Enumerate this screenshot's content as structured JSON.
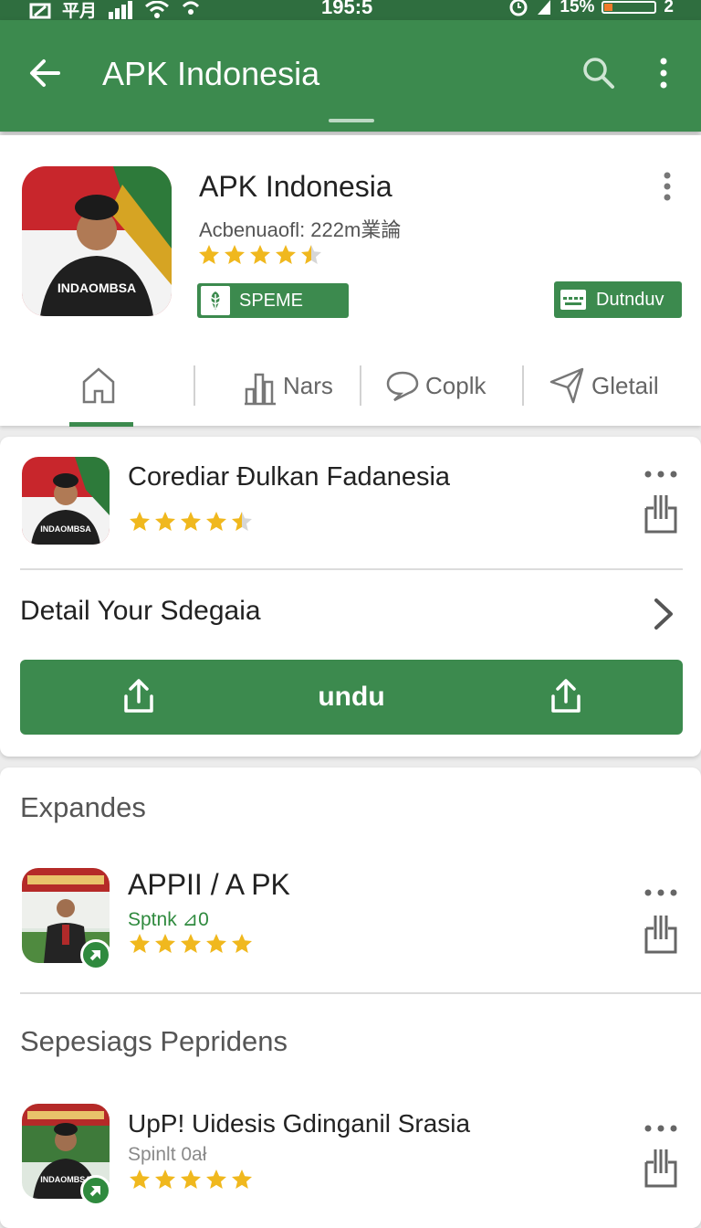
{
  "status_bar": {
    "time": "195:5",
    "left_indicators": "平月",
    "battery_text": "15%",
    "battery_level": 0.15,
    "sim_slot": "2"
  },
  "app_bar": {
    "title": "APK Indonesia",
    "icons": [
      "back-arrow-icon",
      "search-icon",
      "more-vert-icon"
    ]
  },
  "header": {
    "app_name": "APK Indonesia",
    "subtitle": "Acbenuaofl: 222m業論",
    "rating": 4.5,
    "badge_label": "SPEME",
    "download_label": "Dutnduv",
    "tabs": [
      {
        "label": "",
        "icon": "home-icon"
      },
      {
        "label": "Nars",
        "icon": "chart-icon"
      },
      {
        "label": "Coplk",
        "icon": "chat-icon"
      },
      {
        "label": "Gletail",
        "icon": "navigate-icon"
      }
    ],
    "active_tab": 0
  },
  "featured": {
    "title": "Corediar Đulkan Fadanesia",
    "rating": 4.5,
    "detail_label": "Detail Your Sdegaia",
    "primary_button_label": "undu"
  },
  "sections": [
    {
      "title": "Expandes",
      "items": [
        {
          "title": "APPII / A PK",
          "subtitle": "Sptnk ⊿0",
          "subtitle_color": "#2f8a3e",
          "rating": 5
        }
      ]
    },
    {
      "title": "Sepesiags Pepridens",
      "items": [
        {
          "title": "UpP! Uidesis Gdinganil Srasia",
          "subtitle": "Spinlt 0ał",
          "subtitle_color": "#8a8a8a",
          "rating": 5
        }
      ]
    }
  ],
  "colors": {
    "primary": "#3c8a4e",
    "status_bar": "#2f6e3f",
    "star": "#f0b81e",
    "star_empty": "#d6d6d6"
  }
}
